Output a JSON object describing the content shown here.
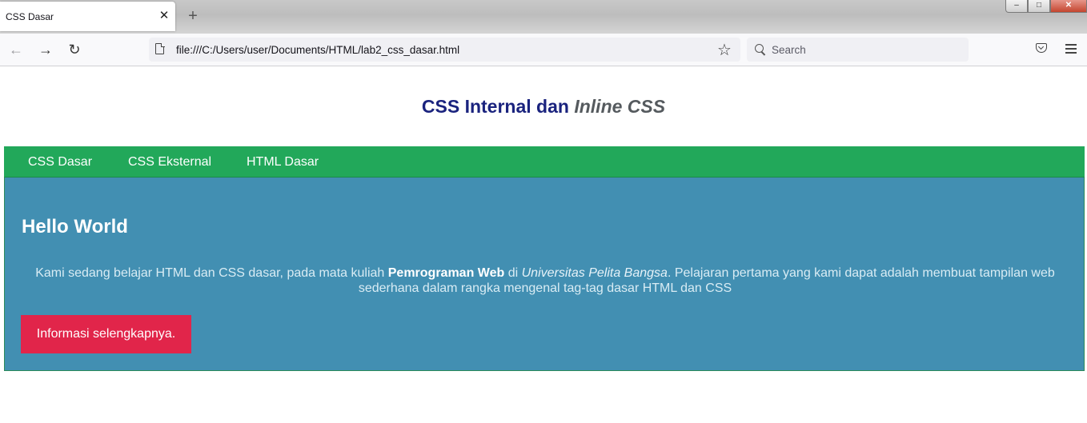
{
  "browser": {
    "tab_title": "CSS Dasar",
    "tab_close": "✕",
    "new_tab": "+",
    "window_controls": {
      "minimize": "–",
      "maximize": "□",
      "close": "✕"
    },
    "nav": {
      "back": "←",
      "forward": "→",
      "reload": "↻"
    },
    "url": "file:///C:/Users/user/Documents/HTML/lab2_css_dasar.html",
    "bookmark_star": "☆",
    "search_placeholder": "Search",
    "icons": [
      "page-icon",
      "star-icon",
      "search-icon",
      "pocket-icon",
      "menu-icon"
    ]
  },
  "page": {
    "heading_main": "CSS Internal dan ",
    "heading_em": "Inline CSS",
    "nav_links": [
      "CSS Dasar",
      "CSS Eksternal",
      "HTML Dasar"
    ],
    "hero": {
      "title": "Hello World",
      "para_1": "Kami sedang belajar HTML dan CSS dasar, pada mata kuliah ",
      "para_bold": "Pemrograman Web",
      "para_2": " di ",
      "para_italic": "Universitas Pelita Bangsa",
      "para_3": ". Pelajaran pertama yang kami dapat adalah membuat tampilan web sederhana dalam rangka mengenal tag-tag dasar HTML dan CSS",
      "button_label": "Informasi selengkapnya."
    }
  },
  "colors": {
    "heading": "#1a237e",
    "heading_em": "#555a5e",
    "nav_bg": "#22a85a",
    "hero_bg": "#428fb2",
    "button_bg": "#e1254a"
  }
}
